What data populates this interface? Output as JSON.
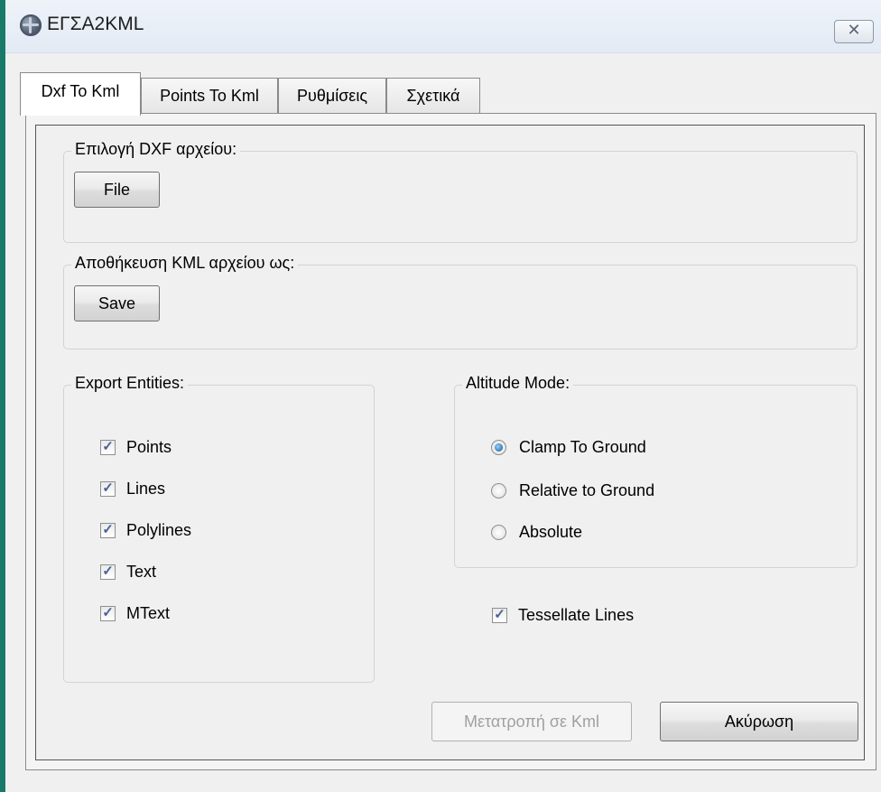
{
  "window": {
    "title": "ΕΓΣΑ2KML",
    "close_glyph": "✕"
  },
  "tabs": [
    {
      "label": "Dxf To Kml",
      "active": true
    },
    {
      "label": "Points To Kml",
      "active": false
    },
    {
      "label": "Ρυθμίσεις",
      "active": false
    },
    {
      "label": "Σχετικά",
      "active": false
    }
  ],
  "dxf_group": {
    "label": "Επιλογή DXF αρχείου:",
    "button": "File"
  },
  "kml_group": {
    "label": "Αποθήκευση KML αρχείου ως:",
    "button": "Save"
  },
  "export_entities": {
    "label": "Export Entities:",
    "items": [
      {
        "label": "Points",
        "checked": true
      },
      {
        "label": "Lines",
        "checked": true
      },
      {
        "label": "Polylines",
        "checked": true
      },
      {
        "label": "Text",
        "checked": true
      },
      {
        "label": "MText",
        "checked": true
      }
    ]
  },
  "altitude_mode": {
    "label": "Altitude Mode:",
    "options": [
      {
        "label": "Clamp To Ground",
        "selected": true
      },
      {
        "label": "Relative to Ground",
        "selected": false
      },
      {
        "label": "Absolute",
        "selected": false
      }
    ]
  },
  "tessellate": {
    "label": "Tessellate Lines",
    "checked": true
  },
  "actions": {
    "convert": "Μετατροπή σε Kml",
    "cancel": "Ακύρωση"
  },
  "check_glyph": "✓",
  "colors": {
    "accent_border": "#1a7a6a",
    "check_mark": "#4a5f97",
    "radio_dot": "#2c78b8"
  }
}
